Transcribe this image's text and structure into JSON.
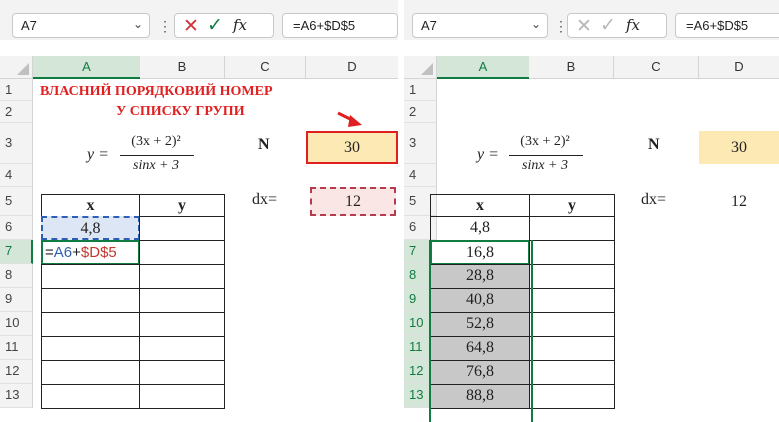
{
  "left": {
    "namebox": "A7",
    "formula": "=A6+$D$5",
    "columns": [
      "A",
      "B",
      "C",
      "D"
    ],
    "rows": [
      "1",
      "2",
      "3",
      "4",
      "5",
      "6",
      "7",
      "8",
      "9",
      "10",
      "11",
      "12",
      "13"
    ],
    "title_line1": "ВЛАСНИЙ ПОРЯДКОВИЙ НОМЕР",
    "title_line2": "У СПИСКУ ГРУПИ",
    "eq_y": "y =",
    "eq_num": "(3x + 2)²",
    "eq_den": "sinx + 3",
    "label_n": "N",
    "value_n": "30",
    "label_dx": "dx=",
    "value_dx": "12",
    "hdr_x": "x",
    "hdr_y": "y",
    "a6": "4,8",
    "a7_parts": {
      "eq": "=",
      "ref1": "A6",
      "plus": "+",
      "ref2": "$D$5"
    }
  },
  "right": {
    "namebox": "A7",
    "formula": "=A6+$D$5",
    "columns": [
      "A",
      "B",
      "C",
      "D"
    ],
    "rows": [
      "1",
      "2",
      "3",
      "4",
      "5",
      "6",
      "7",
      "8",
      "9",
      "10",
      "11",
      "12",
      "13"
    ],
    "eq_y": "y =",
    "eq_num": "(3x + 2)²",
    "eq_den": "sinx + 3",
    "label_n": "N",
    "value_n": "30",
    "label_dx": "dx=",
    "value_dx": "12",
    "hdr_x": "x",
    "hdr_y": "y",
    "x_values": [
      "4,8",
      "16,8",
      "28,8",
      "40,8",
      "52,8",
      "64,8",
      "76,8",
      "88,8"
    ]
  },
  "icons": {
    "cancel": "cancel-x-icon",
    "enter": "checkmark-icon",
    "function": "fx-icon",
    "dropdown": "chevron-down-icon",
    "more": "vertical-dots-icon",
    "arrow": "red-arrow-icon"
  },
  "colors": {
    "accent_green": "#107c41",
    "title_red": "#e02020",
    "n_fill": "#fde9b3",
    "dx_fill": "#fbe6e6",
    "ref_blue": "#2f5fb5",
    "ref_red": "#c0392b",
    "gray_fill": "#c8c8c8"
  }
}
